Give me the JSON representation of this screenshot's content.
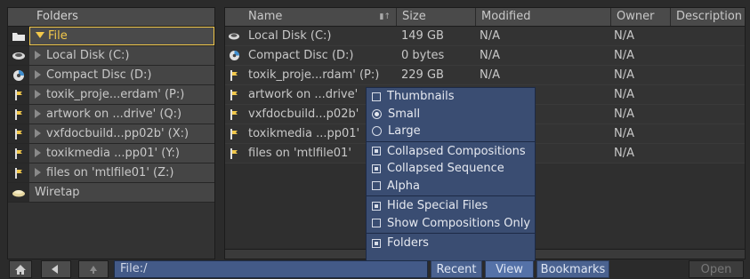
{
  "folders_panel": {
    "header": "Folders",
    "items": [
      {
        "label": "File",
        "icon": "folder-open-icon",
        "expanded": true,
        "selected": true
      },
      {
        "label": "Local Disk (C:)",
        "icon": "hard-disk-icon"
      },
      {
        "label": "Compact Disc (D:)",
        "icon": "cd-icon"
      },
      {
        "label": "toxik_proje...erdam' (P:)",
        "icon": "network-drive-icon"
      },
      {
        "label": "artwork on ...drive' (Q:)",
        "icon": "network-drive-icon"
      },
      {
        "label": "vxfdocbuild...pp02b' (X:)",
        "icon": "network-drive-icon"
      },
      {
        "label": "toxikmedia ...pp01' (Y:)",
        "icon": "network-drive-icon"
      },
      {
        "label": "files on 'mtlfile01' (Z:)",
        "icon": "network-drive-icon"
      },
      {
        "label": "Wiretap",
        "icon": "wiretap-icon"
      }
    ]
  },
  "file_list": {
    "columns": [
      "Name",
      "Size",
      "Modified",
      "Owner",
      "Description"
    ],
    "rows": [
      {
        "icon": "hard-disk-icon",
        "name": "Local Disk (C:)",
        "size": "149 GB",
        "modified": "N/A",
        "owner": "N/A"
      },
      {
        "icon": "cd-icon",
        "name": "Compact Disc (D:)",
        "size": "0 bytes",
        "modified": "N/A",
        "owner": "N/A"
      },
      {
        "icon": "network-drive-icon",
        "name": "toxik_proje...rdam' (P:)",
        "size": "229 GB",
        "modified": "N/A",
        "owner": "N/A"
      },
      {
        "icon": "network-drive-icon",
        "name": "artwork on ...drive'",
        "size": "",
        "modified": "",
        "owner": "N/A"
      },
      {
        "icon": "network-drive-icon",
        "name": "vxfdocbuild...p02b'",
        "size": "",
        "modified": "",
        "owner": "N/A"
      },
      {
        "icon": "network-drive-icon",
        "name": "toxikmedia ...pp01'",
        "size": "",
        "modified": "",
        "owner": "N/A"
      },
      {
        "icon": "network-drive-icon",
        "name": "files on 'mtlfile01'",
        "size": "",
        "modified": "",
        "owner": "N/A"
      }
    ]
  },
  "view_menu": {
    "thumbnails": "Thumbnails",
    "small": "Small",
    "large": "Large",
    "collapsed_compositions": "Collapsed Compositions",
    "collapsed_sequence": "Collapsed Sequence",
    "alpha": "Alpha",
    "hide_special_files": "Hide Special Files",
    "show_compositions_only": "Show Compositions Only",
    "folders": "Folders",
    "state": {
      "thumbnails": false,
      "size": "Small",
      "collapsed_compositions": true,
      "collapsed_sequence": true,
      "alpha": false,
      "hide_special_files": true,
      "show_compositions_only": false,
      "folders": true
    }
  },
  "bottom_bar": {
    "path_value": "File:/",
    "recent": "Recent",
    "view": "View",
    "bookmarks": "Bookmarks",
    "open": "Open"
  },
  "colors": {
    "accent_yellow": "#f2c84b",
    "menu_blue": "#3a4d72",
    "button_blue": "#4a6290"
  }
}
